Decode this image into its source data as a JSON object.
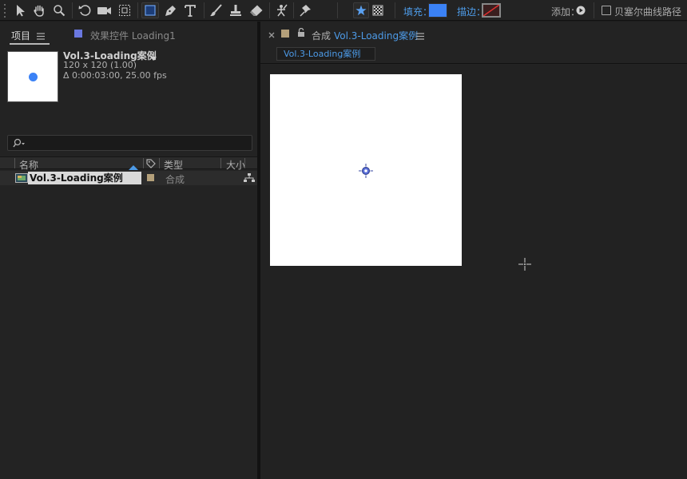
{
  "toolbar": {
    "fill_label": "填充：",
    "fill_color": "#3b82f6",
    "stroke_label": "描边：",
    "add_label": "添加：",
    "bezier_label": "贝塞尔曲线路径",
    "tools": [
      "selection-tool",
      "hand-tool",
      "zoom-tool",
      "rotate-tool",
      "camera-tool",
      "pan-behind-tool",
      "rectangle-tool",
      "pen-tool",
      "type-tool",
      "brush-tool",
      "clone-stamp-tool",
      "eraser-tool",
      "roto-brush-tool",
      "puppet-pin-tool"
    ]
  },
  "project_panel": {
    "tab_project": "项目",
    "tab_effects": "效果控件 Loading1",
    "item_title": "Vol.3-Loading案例",
    "item_size": "120 x 120 (1.00)",
    "item_duration": "Δ 0:00:03:00, 25.00 fps",
    "search_placeholder": "",
    "columns": {
      "name": "名称",
      "type": "类型",
      "size": "大小"
    },
    "rows": [
      {
        "name": "Vol.3-Loading案例",
        "type": "合成",
        "label_color": "#b4a07a"
      }
    ]
  },
  "composition_panel": {
    "tab_prefix": "合成",
    "tab_name": "Vol.3-Loading案例",
    "sub_tab": "Vol.3-Loading案例",
    "accent_color": "#4d9be8"
  }
}
